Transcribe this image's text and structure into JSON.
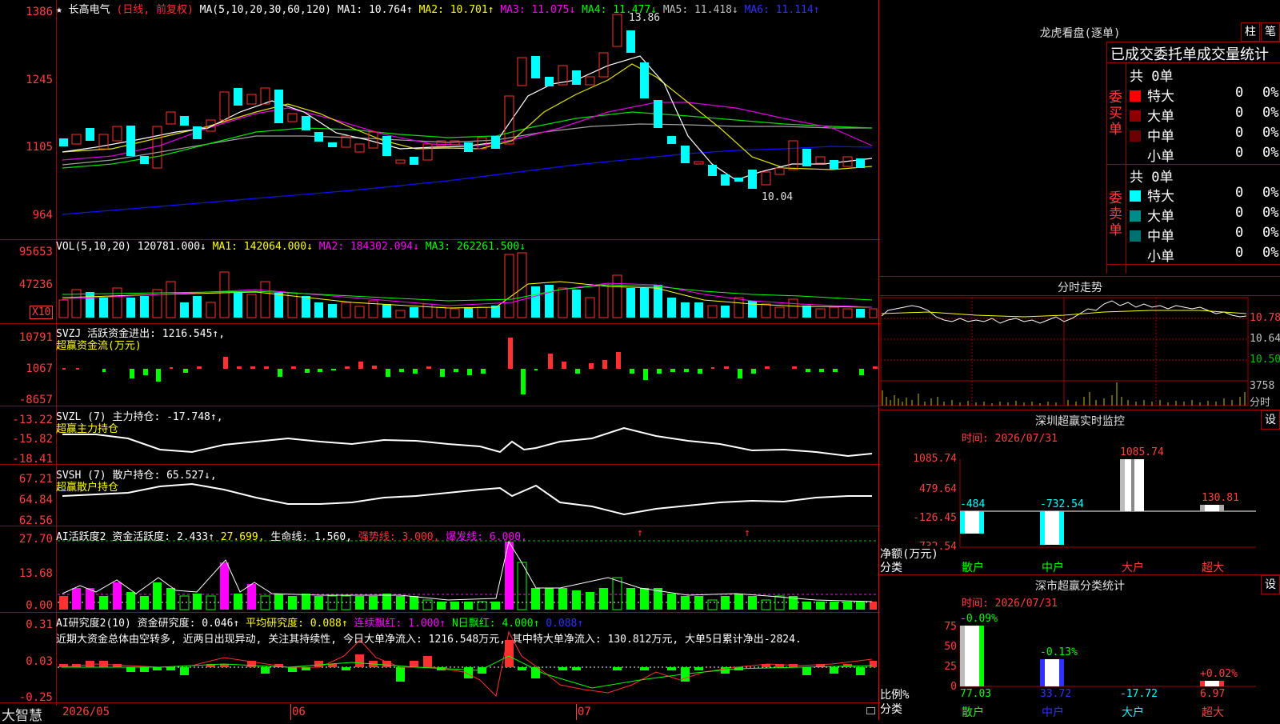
{
  "kline": {
    "stock_name": "长高电气",
    "period_mode": "(日线, 前复权)",
    "ma_prefix": "MA(5,10,20,30,60,120)",
    "ma_values": [
      {
        "label": "MA1: 10.764↑",
        "color": "#ffffff"
      },
      {
        "label": "MA2: 10.701↑",
        "color": "#ffff00"
      },
      {
        "label": "MA3: 11.075↓",
        "color": "#ff00ff"
      },
      {
        "label": "MA4: 11.477↓",
        "color": "#00ff00"
      },
      {
        "label": "MA5: 11.418↓",
        "color": "#c0c0c0"
      },
      {
        "label": "MA6: 11.114↑",
        "color": "#0000ff"
      }
    ],
    "axis_ticks": [
      "1386",
      "1245",
      "1105",
      "964"
    ],
    "high_label": "13.86",
    "low_label": "10.04"
  },
  "vol": {
    "title": "VOL(5,10,20)",
    "value": "120781.000↓",
    "ma1": "MA1: 142064.000↓",
    "ma2": "MA2: 184302.094↓",
    "ma3": "MA3: 262261.500↓",
    "axis_ticks": [
      "95653",
      "47236"
    ],
    "unit": "X10"
  },
  "svzj": {
    "title": "SVZJ  活跃资金进出: 1216.545↑,",
    "subtitle": "超赢资金流(万元)",
    "axis_ticks": [
      "10791",
      "1067",
      "-8657"
    ]
  },
  "svzl": {
    "title": "SVZL (7) 主力持仓: -17.748↑,",
    "subtitle": "超赢主力持仓",
    "axis_ticks": [
      "-13.22",
      "-15.82",
      "-18.41"
    ]
  },
  "svsh": {
    "title": "SVSH (7) 散户持仓: 65.527↓,",
    "subtitle": "超赢散户持仓",
    "axis_ticks": [
      "67.21",
      "64.84",
      "62.56"
    ]
  },
  "ai_active": {
    "title": "AI活跃度2 资金活跃度: 2.433↑",
    "v2": "27.699,",
    "v3": "生命线: 1.560,",
    "v4": "强势线: 3.000,",
    "v5": "爆发线: 6.000,",
    "axis_ticks": [
      "27.70",
      "13.68",
      "0.00"
    ]
  },
  "ai_research": {
    "title": "AI研究度2(10) 资金研究度: 0.046↑",
    "v2": "平均研究度: 0.088↑",
    "v3": "连续飘红: 1.000↑",
    "v4": "N日飘红: 4.000↑",
    "v5": "0.088↑",
    "comment": "近期大资金总体由空转多, 近两日出现异动, 关注其持续性, 今日大单净流入: 1216.548万元, 其中特大单净流入: 130.812万元, 大单5日累计净出-2824.",
    "axis_ticks": [
      "0.31",
      "0.03",
      "-0.25"
    ]
  },
  "bottom_bar": {
    "brand": "大智慧",
    "dates": [
      "2026/05",
      "06",
      "07"
    ]
  },
  "longhu": {
    "title": "龙虎看盘(逐单)",
    "btn1": "柱",
    "btn2": "笔",
    "subtitle": "已成交委托单成交量统计",
    "buy_label": "委买单",
    "sell_label": "委卖单",
    "buy_total": "共 0单",
    "sell_total": "共 0单",
    "buy_rows": [
      {
        "name": "特大",
        "value": "0",
        "pct": "0%",
        "color": "#ff0000"
      },
      {
        "name": "大单",
        "value": "0",
        "pct": "0%",
        "color": "#8b0000"
      },
      {
        "name": "中单",
        "value": "0",
        "pct": "0%",
        "color": "#6b0000"
      },
      {
        "name": "小单",
        "value": "0",
        "pct": "0%",
        "color": ""
      }
    ],
    "sell_rows": [
      {
        "name": "特大",
        "value": "0",
        "pct": "0%",
        "color": "#00ffff"
      },
      {
        "name": "大单",
        "value": "0",
        "pct": "0%",
        "color": "#008b8b"
      },
      {
        "name": "中单",
        "value": "0",
        "pct": "0%",
        "color": "#007070"
      },
      {
        "name": "小单",
        "value": "0",
        "pct": "0%",
        "color": ""
      }
    ]
  },
  "intraday": {
    "title": "分时走势",
    "ticks": [
      "10.78",
      "10.64",
      "10.50"
    ],
    "vol_tick": "3758",
    "unit": "分时"
  },
  "sz_monitor": {
    "title": "深圳超赢实时监控",
    "btn": "设",
    "time": "时间: 2026/07/31",
    "axis_ticks": [
      "1085.74",
      "479.64",
      "-126.45",
      "-732.54"
    ],
    "y_title": "净额(万元)",
    "x_title": "分类",
    "categories": [
      "散户",
      "中户",
      "大户",
      "超大"
    ],
    "bar_labels": [
      "-484",
      "-732.54",
      "1085.74",
      "130.81"
    ]
  },
  "sz_class": {
    "title": "深市超赢分类统计",
    "btn": "设",
    "time": "时间: 2026/07/31",
    "axis_ticks": [
      "75",
      "50",
      "25",
      "0"
    ],
    "y_title": "比例%",
    "x_title": "分类",
    "categories": [
      "散户",
      "中户",
      "大户",
      "超大"
    ],
    "top_labels": [
      "-0.09%",
      "-0.13%",
      "+0.02%"
    ],
    "bottom_values": [
      "77.03",
      "33.72",
      "-17.72",
      "6.97"
    ]
  }
}
